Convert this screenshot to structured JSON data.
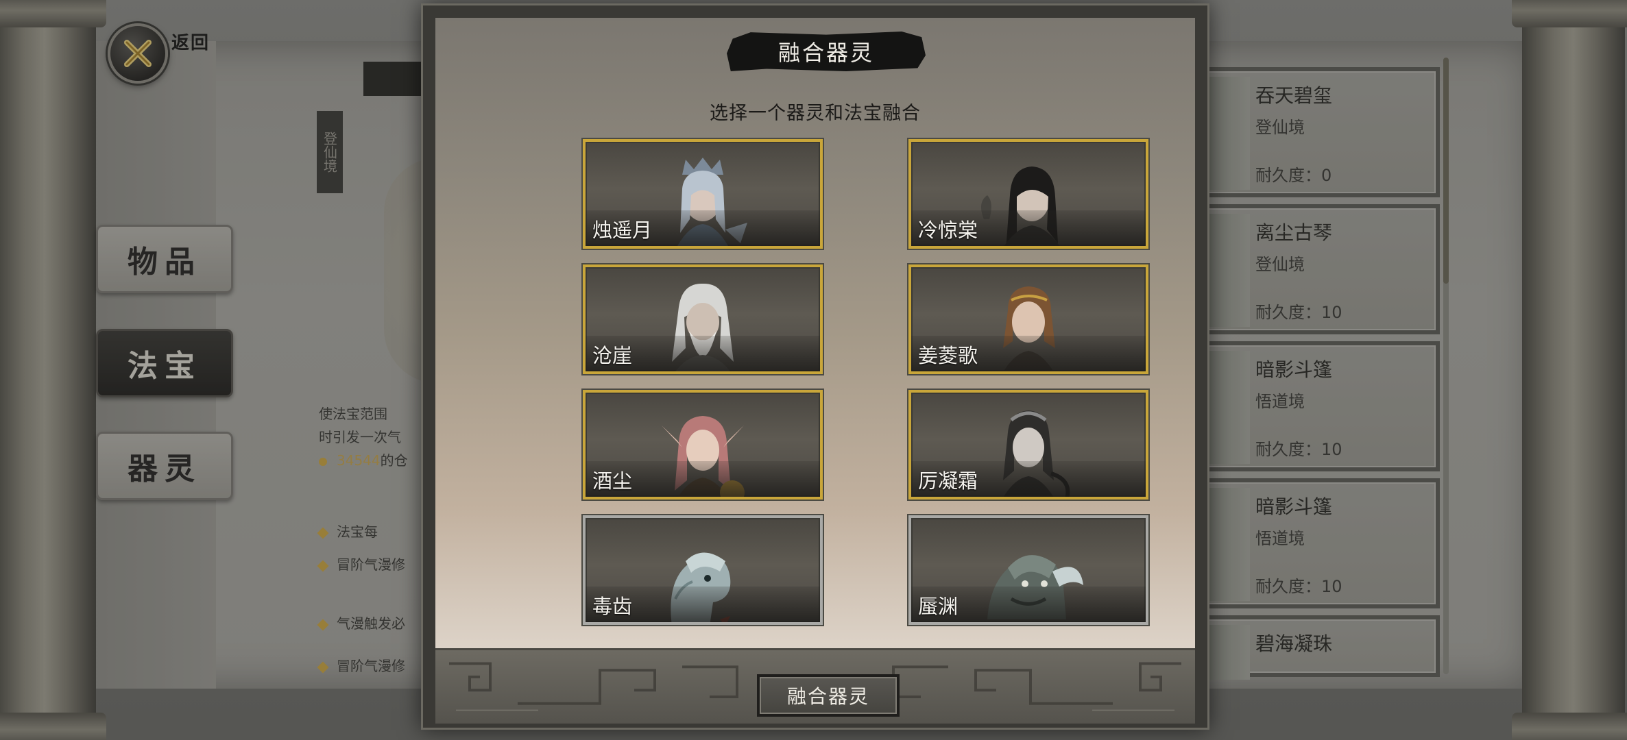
{
  "header": {
    "back_label": "返回"
  },
  "side_tabs": [
    {
      "label": "物品"
    },
    {
      "label": "法宝"
    },
    {
      "label": "器灵"
    }
  ],
  "background_text": {
    "vertical_label": "登仙境",
    "desc_line1": "使法宝范围 ",
    "desc_line2": "时引发一次气",
    "cost_value": "34544",
    "cost_suffix": "的仓",
    "bullets": [
      "法宝每",
      "冒阶气漫修",
      "气漫触发必",
      "冒阶气漫修"
    ]
  },
  "right_list": [
    {
      "name": "吞天碧玺",
      "rank": "登仙境",
      "durability": "耐久度：0"
    },
    {
      "name": "离尘古琴",
      "rank": "登仙境",
      "durability": "耐久度：10"
    },
    {
      "name": "暗影斗篷",
      "rank": "悟道境",
      "durability": "耐久度：10"
    },
    {
      "name": "暗影斗篷",
      "rank": "悟道境",
      "durability": "耐久度：10"
    },
    {
      "name": "碧海凝珠",
      "rank": "",
      "durability": ""
    }
  ],
  "modal": {
    "title": "融合器灵",
    "subtitle": "选择一个器灵和法宝融合",
    "spirits": [
      {
        "name": "烛遥月",
        "frame": "gold",
        "portrait": "female-silver-hair-icon"
      },
      {
        "name": "冷惊棠",
        "frame": "gold",
        "portrait": "male-black-hair-icon"
      },
      {
        "name": "沧崖",
        "frame": "gold",
        "portrait": "old-sage-white-beard-icon"
      },
      {
        "name": "姜菱歌",
        "frame": "gold",
        "portrait": "female-brown-hair-icon"
      },
      {
        "name": "酒尘",
        "frame": "gold",
        "portrait": "pink-hair-elf-icon"
      },
      {
        "name": "厉凝霜",
        "frame": "gold",
        "portrait": "female-dark-hair-icon"
      },
      {
        "name": "毒齿",
        "frame": "silver",
        "portrait": "serpent-icon"
      },
      {
        "name": "蜃渊",
        "frame": "silver",
        "portrait": "dragon-icon"
      }
    ],
    "fuse_button": "融合器灵"
  },
  "colors": {
    "gold_frame": "#c9a63a",
    "silver_frame": "#a9a9a6",
    "modal_bg_top": "#7b7770",
    "modal_bg_bottom": "#ddd3c8"
  }
}
